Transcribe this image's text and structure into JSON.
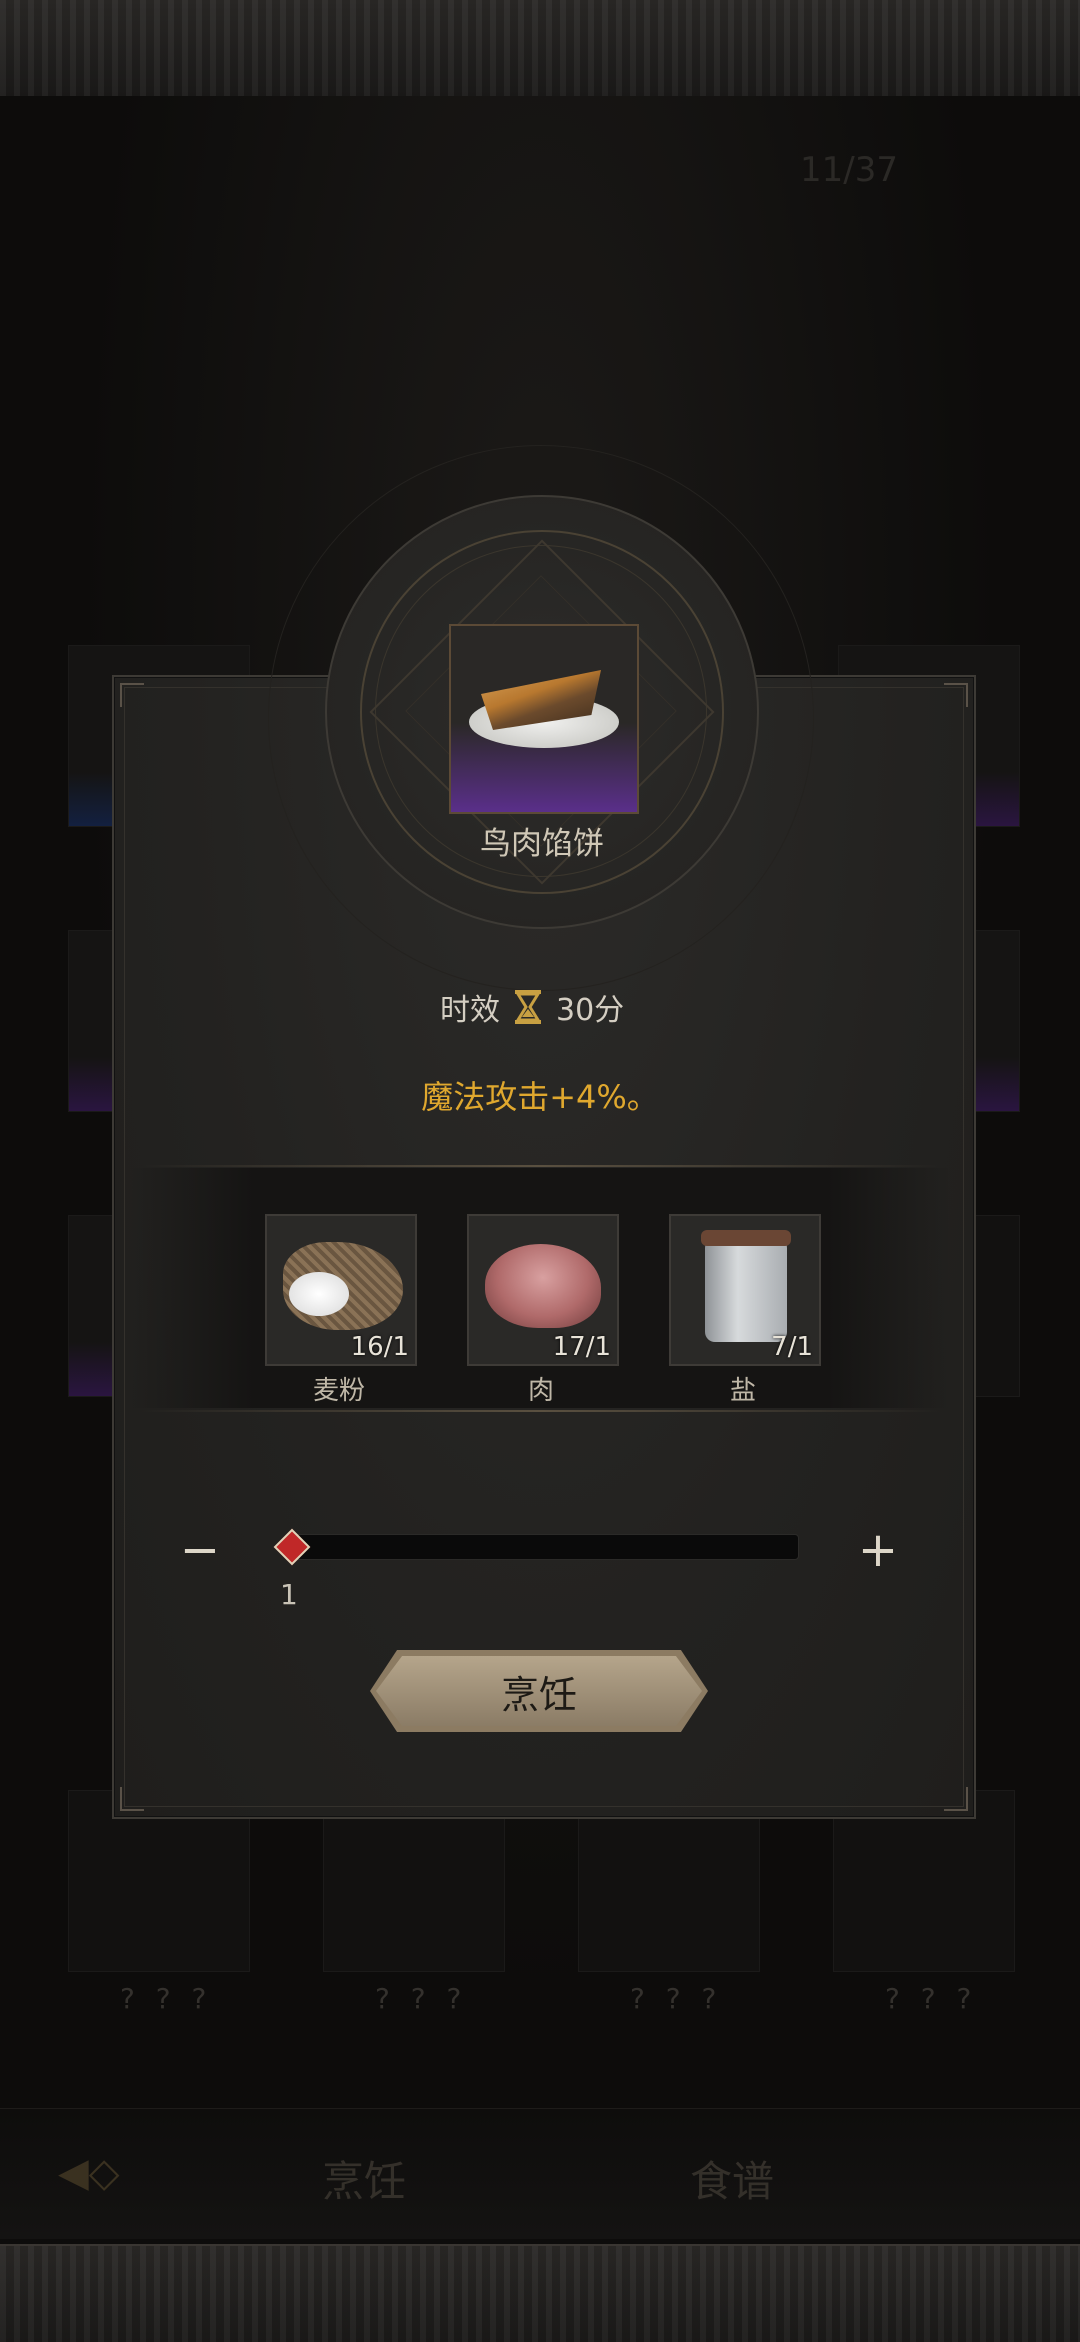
{
  "background": {
    "counter": "11/37",
    "locked_labels": [
      "? ? ?",
      "? ? ?",
      "? ? ?",
      "? ? ?"
    ],
    "tabs": {
      "cook": "烹饪",
      "recipe": "食谱"
    }
  },
  "recipe": {
    "name": "鸟肉馅饼",
    "duration_label": "时效",
    "duration_value": "30分",
    "effect": "魔法攻击+4%。"
  },
  "materials": [
    {
      "label": "麦粉",
      "count": "16/1",
      "icon": "flour-sack-icon"
    },
    {
      "label": "肉",
      "count": "17/1",
      "icon": "meat-icon"
    },
    {
      "label": "盐",
      "count": "7/1",
      "icon": "salt-jar-icon"
    }
  ],
  "quantity": {
    "value": "1",
    "minus": "−",
    "plus": "+"
  },
  "actions": {
    "cook": "烹饪"
  },
  "colors": {
    "effect": "#e0a82e",
    "rarity": "#5a2f8a",
    "slider_handle": "#c02828"
  }
}
